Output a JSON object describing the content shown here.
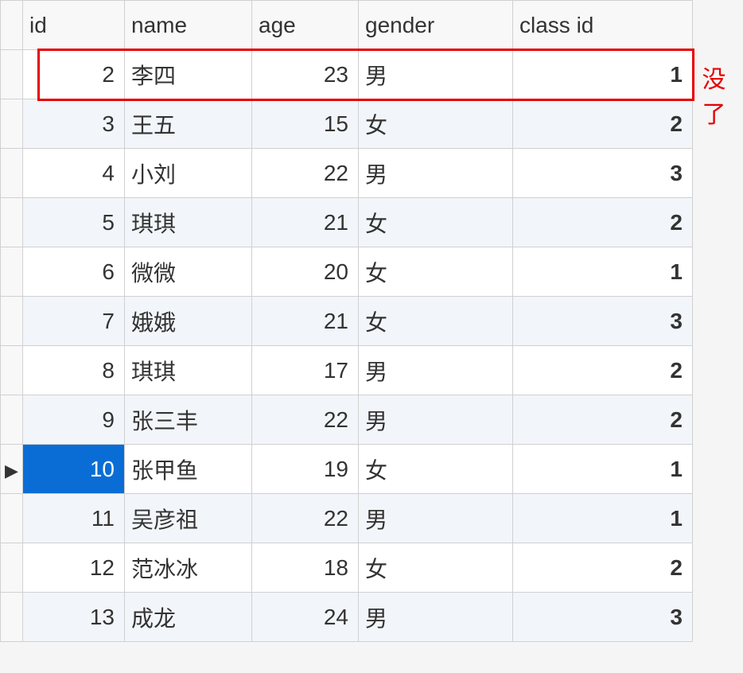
{
  "columns": {
    "id": "id",
    "name": "name",
    "age": "age",
    "gender": "gender",
    "class_id": "class id"
  },
  "rows": [
    {
      "id": "2",
      "name": "李四",
      "age": "23",
      "gender": "男",
      "class_id": "1"
    },
    {
      "id": "3",
      "name": "王五",
      "age": "15",
      "gender": "女",
      "class_id": "2"
    },
    {
      "id": "4",
      "name": "小刘",
      "age": "22",
      "gender": "男",
      "class_id": "3"
    },
    {
      "id": "5",
      "name": "琪琪",
      "age": "21",
      "gender": "女",
      "class_id": "2"
    },
    {
      "id": "6",
      "name": "微微",
      "age": "20",
      "gender": "女",
      "class_id": "1"
    },
    {
      "id": "7",
      "name": "娥娥",
      "age": "21",
      "gender": "女",
      "class_id": "3"
    },
    {
      "id": "8",
      "name": "琪琪",
      "age": "17",
      "gender": "男",
      "class_id": "2"
    },
    {
      "id": "9",
      "name": "张三丰",
      "age": "22",
      "gender": "男",
      "class_id": "2"
    },
    {
      "id": "10",
      "name": "张甲鱼",
      "age": "19",
      "gender": "女",
      "class_id": "1"
    },
    {
      "id": "11",
      "name": "吴彦祖",
      "age": "22",
      "gender": "男",
      "class_id": "1"
    },
    {
      "id": "12",
      "name": "范冰冰",
      "age": "18",
      "gender": "女",
      "class_id": "2"
    },
    {
      "id": "13",
      "name": "成龙",
      "age": "24",
      "gender": "男",
      "class_id": "3"
    }
  ],
  "selected_row_index": 8,
  "row_marker": "▶",
  "annotation": "没了",
  "highlight_row_index": 0
}
